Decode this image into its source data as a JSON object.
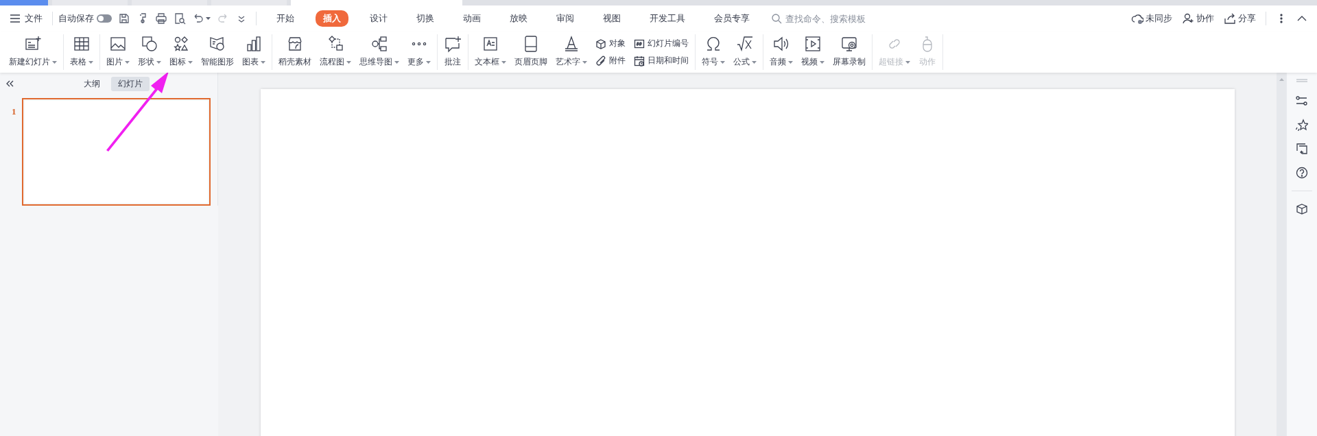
{
  "menu": {
    "file_label": "文件",
    "autosave": {
      "label": "自动保存",
      "on": false
    },
    "quick_access": [
      {
        "disabled": false
      },
      {
        "disabled": false
      },
      {
        "disabled": false
      },
      {
        "disabled": false
      },
      {
        "disabled": false
      },
      {
        "disabled": true
      },
      {
        "disabled": false
      }
    ],
    "tabs": [
      {
        "label": "开始",
        "selected": false
      },
      {
        "label": "插入",
        "selected": true
      },
      {
        "label": "设计",
        "selected": false
      },
      {
        "label": "切换",
        "selected": false
      },
      {
        "label": "动画",
        "selected": false
      },
      {
        "label": "放映",
        "selected": false
      },
      {
        "label": "审阅",
        "selected": false
      },
      {
        "label": "视图",
        "selected": false
      },
      {
        "label": "开发工具",
        "selected": false
      },
      {
        "label": "会员专享",
        "selected": false
      }
    ],
    "search": {
      "placeholder": "查找命令、搜索模板"
    },
    "actions": [
      {
        "label": "未同步"
      },
      {
        "label": "协作"
      },
      {
        "label": "分享"
      }
    ]
  },
  "ribbon": {
    "groups": [
      {
        "items": [
          {
            "kind": "large",
            "label": "新建幻灯片",
            "dropdown": true,
            "disabled": false
          }
        ]
      },
      {
        "items": [
          {
            "kind": "large",
            "label": "表格",
            "dropdown": true,
            "disabled": false
          }
        ]
      },
      {
        "items": [
          {
            "kind": "large",
            "label": "图片",
            "dropdown": true,
            "disabled": false
          },
          {
            "kind": "large",
            "label": "形状",
            "dropdown": true,
            "disabled": false
          },
          {
            "kind": "large",
            "label": "图标",
            "dropdown": true,
            "disabled": false
          },
          {
            "kind": "large",
            "label": "智能图形",
            "dropdown": false,
            "disabled": false
          },
          {
            "kind": "large",
            "label": "图表",
            "dropdown": true,
            "disabled": false
          }
        ]
      },
      {
        "items": [
          {
            "kind": "large",
            "label": "稻壳素材",
            "dropdown": false,
            "disabled": false
          },
          {
            "kind": "large",
            "label": "流程图",
            "dropdown": true,
            "disabled": false
          },
          {
            "kind": "large",
            "label": "思维导图",
            "dropdown": true,
            "disabled": false
          },
          {
            "kind": "large",
            "label": "更多",
            "dropdown": true,
            "disabled": false
          }
        ]
      },
      {
        "items": [
          {
            "kind": "large",
            "label": "批注",
            "dropdown": false,
            "disabled": false
          }
        ]
      },
      {
        "items": [
          {
            "kind": "large",
            "label": "文本框",
            "dropdown": true,
            "disabled": false
          },
          {
            "kind": "large",
            "label": "页眉页脚",
            "dropdown": false,
            "disabled": false
          },
          {
            "kind": "large",
            "label": "艺术字",
            "dropdown": true,
            "disabled": false
          },
          {
            "kind": "stack",
            "rows": [
              {
                "label": "对象"
              },
              {
                "label": "附件"
              }
            ]
          },
          {
            "kind": "stack",
            "rows": [
              {
                "label": "幻灯片编号"
              },
              {
                "label": "日期和时间"
              }
            ]
          }
        ]
      },
      {
        "items": [
          {
            "kind": "large",
            "label": "符号",
            "dropdown": true,
            "disabled": false
          },
          {
            "kind": "large",
            "label": "公式",
            "dropdown": true,
            "disabled": false
          }
        ]
      },
      {
        "items": [
          {
            "kind": "large",
            "label": "音频",
            "dropdown": true,
            "disabled": false
          },
          {
            "kind": "large",
            "label": "视频",
            "dropdown": true,
            "disabled": false
          },
          {
            "kind": "large",
            "label": "屏幕录制",
            "dropdown": false,
            "disabled": false
          }
        ]
      },
      {
        "items": [
          {
            "kind": "large",
            "label": "超链接",
            "dropdown": true,
            "disabled": true
          },
          {
            "kind": "large",
            "label": "动作",
            "dropdown": false,
            "disabled": true
          }
        ]
      }
    ]
  },
  "slide_panel": {
    "view_tabs": [
      {
        "label": "大纲",
        "selected": false
      },
      {
        "label": "幻灯片",
        "selected": true
      }
    ],
    "slides": [
      {
        "number": "1",
        "selected": true
      }
    ]
  }
}
